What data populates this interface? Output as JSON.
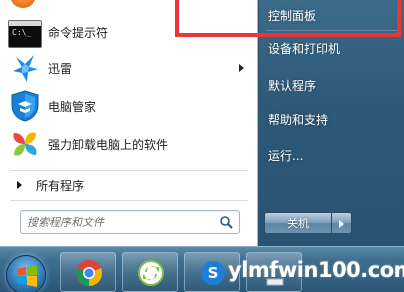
{
  "start_menu": {
    "programs": [
      {
        "label": "命令提示符",
        "icon": "cmd-icon"
      },
      {
        "label": "迅雷",
        "icon": "xunlei-icon",
        "has_submenu": true
      },
      {
        "label": "电脑管家",
        "icon": "pc-manager-shield-icon"
      },
      {
        "label": "强力卸载电脑上的软件",
        "icon": "uninstaller-pinwheel-icon"
      }
    ],
    "all_programs_label": "所有程序",
    "search_placeholder": "搜索程序和文件",
    "right_items": [
      {
        "label": "控制面板"
      },
      {
        "label": "设备和打印机"
      },
      {
        "label": "默认程序"
      },
      {
        "label": "帮助和支持"
      },
      {
        "label": "运行..."
      }
    ],
    "shutdown_label": "关机",
    "highlight_color": "#e8373b"
  },
  "cmd_icon_text": "C:\\_",
  "taskbar": {
    "apps": [
      "chrome-icon",
      "refresh-arrows-icon",
      "sogou-icon",
      "pinned-app-icon"
    ]
  },
  "watermark": "ylmfwin100.com"
}
